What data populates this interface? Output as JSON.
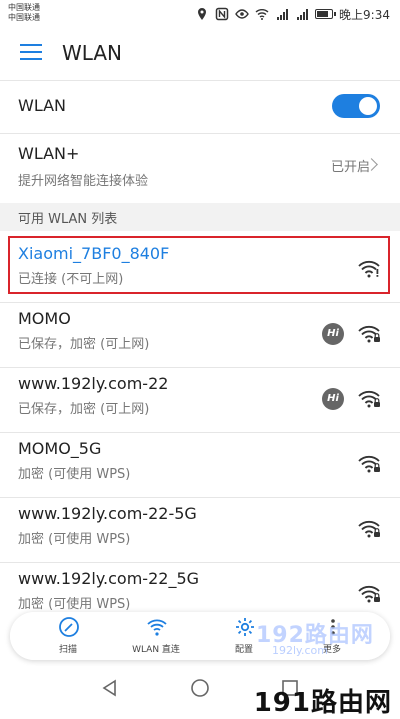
{
  "status_bar": {
    "carrier_1": "中国联通",
    "carrier_2": "中国联通",
    "time": "晚上9:34"
  },
  "app_bar": {
    "title": "WLAN"
  },
  "wlan_row": {
    "label": "WLAN",
    "toggle_on": true
  },
  "wlan_plus_row": {
    "label": "WLAN+",
    "subtitle": "提升网络智能连接体验",
    "status": "已开启"
  },
  "section": {
    "label": "可用 WLAN 列表"
  },
  "networks": [
    {
      "name": "Xiaomi_7BF0_840F",
      "status": "已连接 (不可上网)",
      "hi_badge": false,
      "locked": false,
      "warning": true,
      "connected": true
    },
    {
      "name": "MOMO",
      "status": "已保存，加密 (可上网)",
      "hi_badge": true,
      "hi_label": "Hi",
      "locked": true,
      "warning": false,
      "connected": false
    },
    {
      "name": "www.192ly.com-22",
      "status": "已保存，加密 (可上网)",
      "hi_badge": true,
      "hi_label": "Hi",
      "locked": true,
      "warning": false,
      "connected": false
    },
    {
      "name": "MOMO_5G",
      "status": "加密 (可使用 WPS)",
      "hi_badge": false,
      "locked": true,
      "warning": false,
      "connected": false
    },
    {
      "name": "www.192ly.com-22-5G",
      "status": "加密 (可使用 WPS)",
      "hi_badge": false,
      "locked": true,
      "warning": false,
      "connected": false
    },
    {
      "name": "www.192ly.com-22_5G",
      "status": "加密 (可使用 WPS)",
      "hi_badge": false,
      "locked": true,
      "warning": false,
      "connected": false
    }
  ],
  "bottom_bar": {
    "scan": "扫描",
    "wlan_direct": "WLAN 直连",
    "config": "配置",
    "more": "更多"
  },
  "watermarks": {
    "overlay": "192路由网",
    "overlay_sub": "192ly.com",
    "corner": "191路由网"
  },
  "colors": {
    "accent": "#1e7fe0",
    "highlight_border": "#d9242b"
  }
}
